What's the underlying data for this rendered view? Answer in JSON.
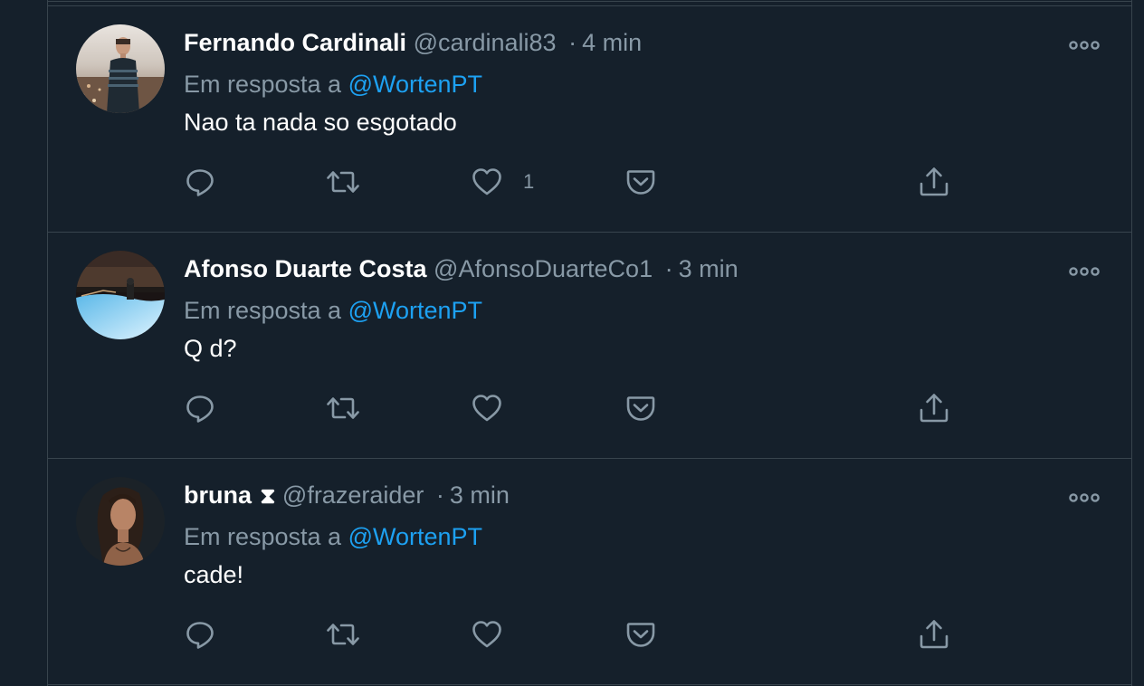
{
  "colors": {
    "background": "#15202b",
    "border": "#38444d",
    "primary_text": "#ffffff",
    "secondary_text": "#8899a6",
    "mention": "#1da1f2"
  },
  "tweets": [
    {
      "display_name": "Fernando Cardinali",
      "handle": "@cardinali83",
      "separator": "·",
      "time": "4 min",
      "reply_prefix": "Em resposta a",
      "reply_to": "@WortenPT",
      "text": "Nao ta nada so esgotado",
      "like_count": "1",
      "avatar": "man-standing-photo-avatar"
    },
    {
      "display_name": "Afonso Duarte Costa",
      "handle": "@AfonsoDuarteCo1",
      "separator": "·",
      "time": "3 min",
      "reply_prefix": "Em resposta a",
      "reply_to": "@WortenPT",
      "text": "Q d?",
      "like_count": "",
      "avatar": "pool-night-photo-avatar"
    },
    {
      "display_name": "bruna",
      "name_glyph": "⧗",
      "handle": "@frazeraider",
      "separator": "·",
      "time": "3 min",
      "reply_prefix": "Em resposta a",
      "reply_to": "@WortenPT",
      "text": "cade!",
      "like_count": "",
      "avatar": "woman-portrait-photo-avatar"
    }
  ],
  "icons": {
    "more": "more-options-icon",
    "reply": "reply-icon",
    "retweet": "retweet-icon",
    "like": "like-icon",
    "pocket": "pocket-icon",
    "share": "share-icon"
  }
}
